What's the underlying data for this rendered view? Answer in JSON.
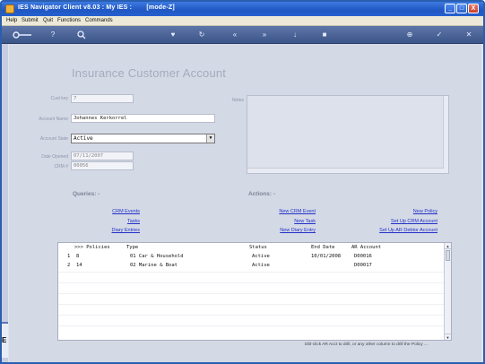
{
  "window": {
    "title": "IES Navigator Client v8.03 : My IES :",
    "mode": "[mode-Z]",
    "controls": {
      "minimize": "_",
      "maximize": "□",
      "close": "X"
    }
  },
  "menu": {
    "items": [
      "Help",
      "Submit",
      "Quit",
      "Functions",
      "Commands"
    ]
  },
  "toolbar": {
    "icons": [
      "key-icon",
      "help-icon",
      "search-icon",
      "heart-icon",
      "refresh-icon",
      "rewind-icon",
      "fast-forward-icon",
      "down-icon",
      "stop-icon",
      "globe-icon",
      "check-icon",
      "close-icon"
    ]
  },
  "form": {
    "heading": "Insurance Customer Account",
    "cust_key_label": "Cust key",
    "cust_key_value": "7",
    "account_name_label": "Account Name",
    "account_name_value": "Johannes Kerkorrel",
    "account_state_label": "Account State",
    "account_state_value": "Active",
    "date_opened_label": "Date Opened",
    "date_opened_value": "07/11/2007",
    "crm_label": "CRM #",
    "crm_value": "00056",
    "notes_label": "Notes"
  },
  "queries": {
    "title": "Queries: -",
    "links": [
      "CRM Events",
      "Tasks",
      "Diary Entries"
    ]
  },
  "actions": {
    "title": "Actions: -",
    "links_left": [
      "New CRM Event",
      "New Task",
      "New Diary Entry"
    ],
    "links_right": [
      "New Policy",
      "Set Up CRM Account",
      "Set Up AR Debtor Account"
    ]
  },
  "policies": {
    "headers": [
      ">>> Policies",
      "Type",
      "Status",
      "End Date",
      "AR Account"
    ],
    "rows": [
      {
        "num": "1",
        "policy": "8",
        "type": "01 Car & Household",
        "status": "Active",
        "end_date": "10/01/2008",
        "ar_account": "D00016"
      },
      {
        "num": "2",
        "policy": "14",
        "type": "02 Marine & Boat",
        "status": "Active",
        "end_date": "",
        "ar_account": "D00017"
      }
    ]
  },
  "hint": "Dbl-click AR Acct to drill, or any other column to drill the Policy ...",
  "side_marker": "E",
  "colors": {
    "titlebar": "#1f57c4",
    "toolbar": "#3c5589",
    "link": "#2231c8",
    "panel": "#d4d9e6"
  }
}
